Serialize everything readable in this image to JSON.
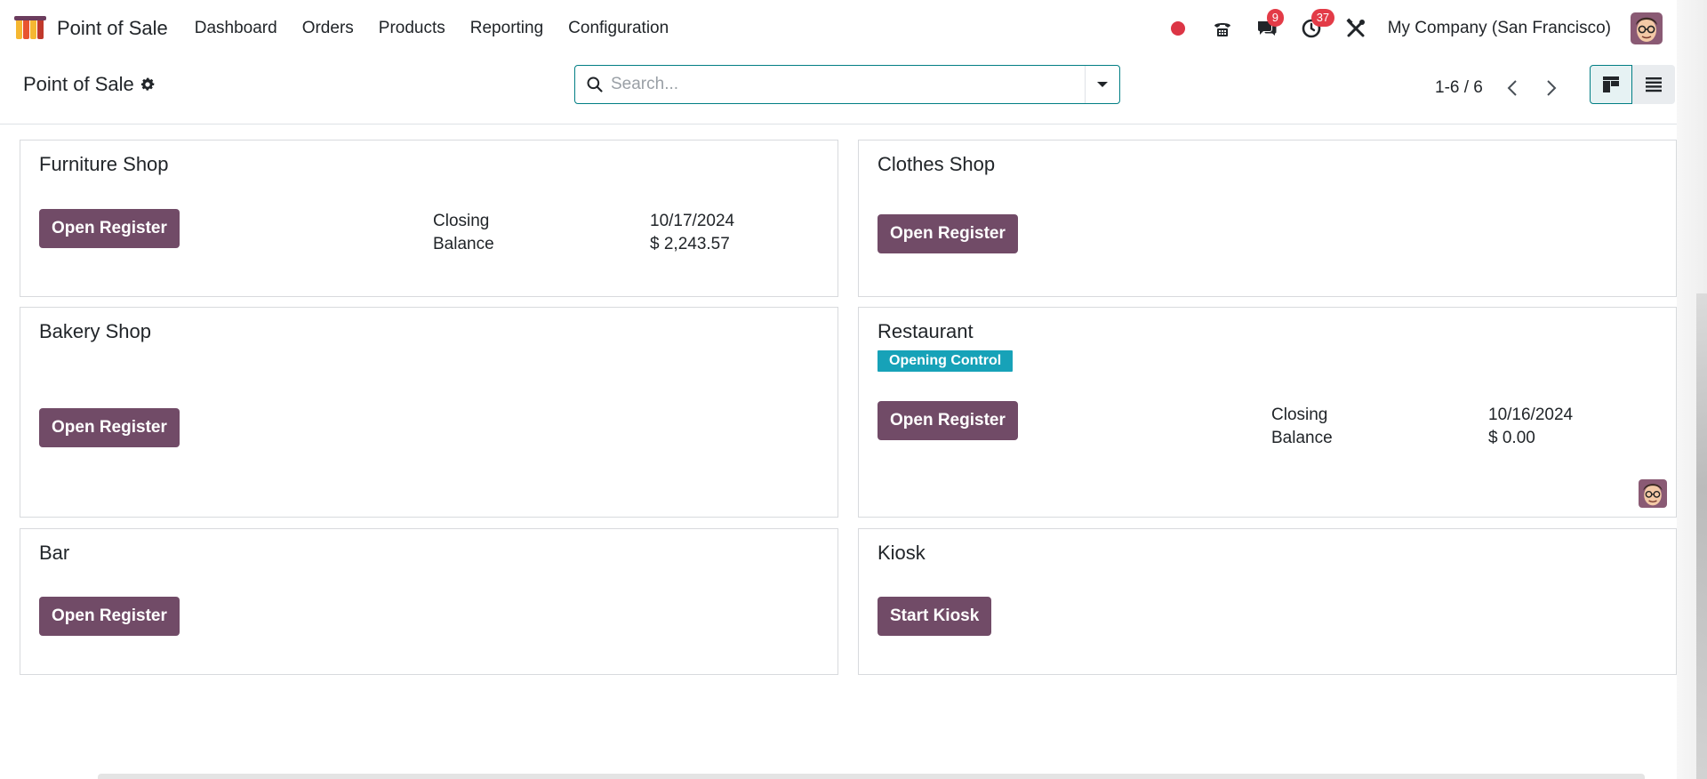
{
  "navbar": {
    "app_name": "Point of Sale",
    "menu": [
      {
        "label": "Dashboard"
      },
      {
        "label": "Orders"
      },
      {
        "label": "Products"
      },
      {
        "label": "Reporting"
      },
      {
        "label": "Configuration"
      }
    ],
    "messages_count": "9",
    "activities_count": "37",
    "company": "My Company (San Francisco)"
  },
  "control_panel": {
    "title": "Point of Sale",
    "search_placeholder": "Search...",
    "pager": "1-6 / 6"
  },
  "cards": [
    {
      "name": "Furniture Shop",
      "button": "Open Register",
      "closing_label": "Closing",
      "closing_value": "10/17/2024",
      "balance_label": "Balance",
      "balance_value": "$ 2,243.57"
    },
    {
      "name": "Clothes Shop",
      "button": "Open Register"
    },
    {
      "name": "Bakery Shop",
      "button": "Open Register"
    },
    {
      "name": "Restaurant",
      "status": "Opening Control",
      "button": "Open Register",
      "closing_label": "Closing",
      "closing_value": "10/16/2024",
      "balance_label": "Balance",
      "balance_value": "$ 0.00"
    },
    {
      "name": "Bar",
      "button": "Open Register"
    },
    {
      "name": "Kiosk",
      "button": "Start Kiosk"
    }
  ],
  "colors": {
    "primary": "#714b67",
    "accent": "#017e84",
    "badge_info": "#17a2b8",
    "notification": "#e33b47",
    "recording": "#dc3545"
  }
}
